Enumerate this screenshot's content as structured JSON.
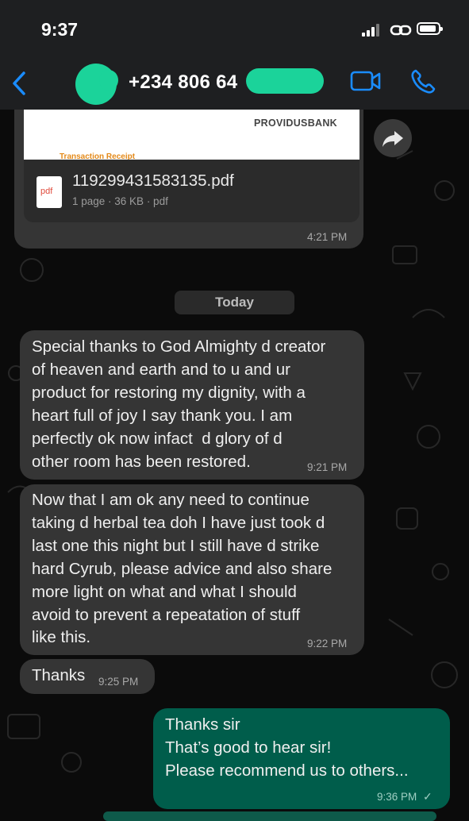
{
  "status_bar": {
    "time": "9:37"
  },
  "header": {
    "contact": "+234 806 64"
  },
  "messages": [
    {
      "type": "document",
      "direction": "incoming",
      "preview_brand": "PROVIDUSBANK",
      "preview_title": "Transaction Receipt",
      "icon_label": "pdf",
      "filename": "119299431583135.pdf",
      "meta": "1 page · 36 KB · pdf",
      "time": "4:21 PM"
    },
    {
      "type": "divider",
      "label": "Today"
    },
    {
      "type": "text",
      "direction": "incoming",
      "text": "Special thanks to God Almighty d creator\nof heaven and earth and to u and ur\nproduct for restoring my dignity, with a\nheart full of joy I say thank you. I am\nperfectly ok now infact  d glory of d\nother room has been restored.",
      "time": "9:21 PM"
    },
    {
      "type": "text",
      "direction": "incoming",
      "text": "Now that I am ok any need to continue\ntaking d herbal tea doh I have just took d\nlast one this night but I still have d strike\nhard Cyrub, please advice and also share\nmore light on what and what I should\navoid to prevent a repeatation of stuff\nlike this.",
      "time": "9:22 PM"
    },
    {
      "type": "text",
      "direction": "incoming",
      "text": "Thanks",
      "time": "9:25 PM"
    },
    {
      "type": "text",
      "direction": "outgoing",
      "text": "Thanks sir\nThat’s good to hear sir!\nPlease recommend us to others...",
      "time": "9:36 PM",
      "status": "✓"
    }
  ],
  "icons": {
    "back": "chevron-left-icon",
    "video": "video-call-icon",
    "call": "phone-icon",
    "forward": "forward-arrow-icon",
    "document": "pdf-file-icon"
  },
  "colors": {
    "accent": "#1a8cff",
    "outgoing_bubble": "#005d4b",
    "incoming_bubble": "#353535",
    "header": "#1e1f21"
  }
}
